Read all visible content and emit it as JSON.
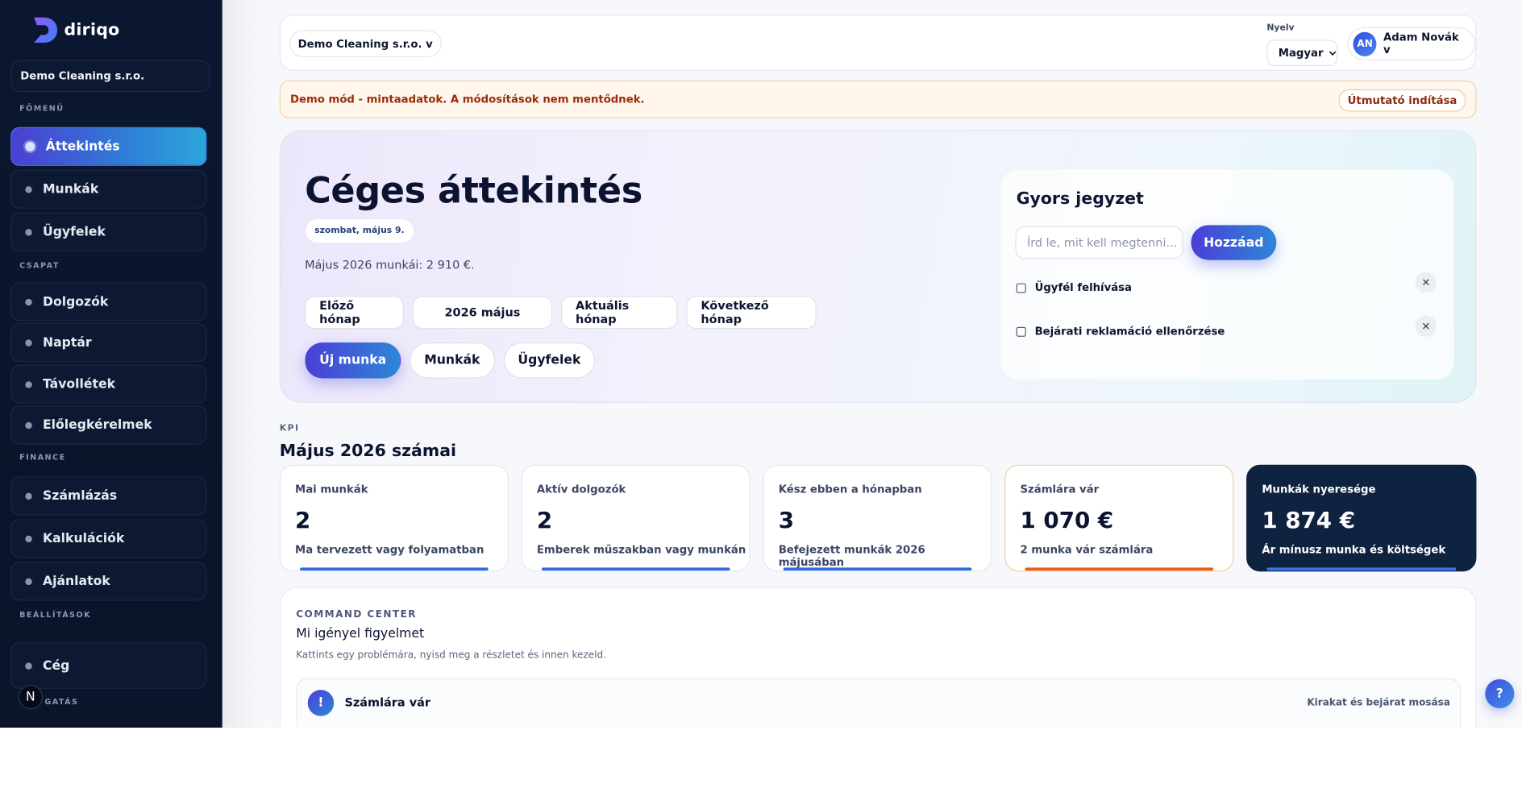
{
  "brand": {
    "name": "diriqo"
  },
  "sidebar": {
    "company": "Demo Cleaning s.r.o.",
    "sections": {
      "main": "FŐMENÜ",
      "team": "CSAPAT",
      "finance": "FINANCE",
      "settings": "BEÁLLÍTÁSOK",
      "support": "GATÁS"
    },
    "items": {
      "overview": "Áttekintés",
      "jobs": "Munkák",
      "clients": "Ügyfelek",
      "workers": "Dolgozók",
      "calendar": "Naptár",
      "absences": "Távollétek",
      "advances": "Előlegkérelmek",
      "invoicing": "Számlázás",
      "calculations": "Kalkulációk",
      "offers": "Ajánlatok",
      "company": "Cég"
    },
    "badge": "N"
  },
  "topbar": {
    "company_select": "Demo Cleaning s.r.o. v",
    "lang_label": "Nyelv",
    "lang_value": "Magyar",
    "user_initials": "AN",
    "user_name": "Adam Novák v"
  },
  "demo": {
    "text": "Demo mód - mintaadatok. A módosítások nem mentődnek.",
    "button": "Útmutató indítása"
  },
  "hero": {
    "title": "Céges áttekintés",
    "date": "szombat, május 9.",
    "summary": "Május 2026 munkái: 2 910 €.",
    "month_buttons": [
      "Előző hónap",
      "2026 május",
      "Aktuális hónap",
      "Következő hónap"
    ],
    "action_buttons": [
      "Új munka",
      "Munkák",
      "Ügyfelek"
    ]
  },
  "notes": {
    "title": "Gyors jegyzet",
    "placeholder": "Írd le, mit kell megtenni...",
    "add": "Hozzáad",
    "items": [
      "Ügyfél felhívása",
      "Bejárati reklamáció ellenőrzése"
    ]
  },
  "kpi": {
    "tag": "KPI",
    "title": "Május 2026 számai",
    "cards": [
      {
        "label": "Mai munkák",
        "value": "2",
        "sub": "Ma tervezett vagy folyamatban"
      },
      {
        "label": "Aktív dolgozók",
        "value": "2",
        "sub": "Emberek műszakban vagy munkán"
      },
      {
        "label": "Kész ebben a hónapban",
        "value": "3",
        "sub": "Befejezett munkák 2026 májusában"
      },
      {
        "label": "Számlára vár",
        "value": "1 070 €",
        "sub": "2 munka vár számlára"
      },
      {
        "label": "Munkák nyeresége",
        "value": "1 874 €",
        "sub": "Ár mínusz munka és költségek"
      }
    ]
  },
  "command_center": {
    "tag": "COMMAND CENTER",
    "title": "Mi igényel figyelmet",
    "subtitle": "Kattints egy problémára, nyisd meg a részletet és innen kezeld.",
    "row_icon": "!",
    "row_title": "Számlára vár",
    "row_meta": "Kirakat és bejárat mosása"
  },
  "help": "?",
  "icons": {
    "nav_dot": "dot-icon",
    "chevron": "chevron-down-icon",
    "close": "close-icon"
  },
  "colors": {
    "accent_start": "#4a3fd7",
    "accent_end": "#2f86d6",
    "sidebar_bg": "#0b1630",
    "warn": "#ef5a1a"
  }
}
